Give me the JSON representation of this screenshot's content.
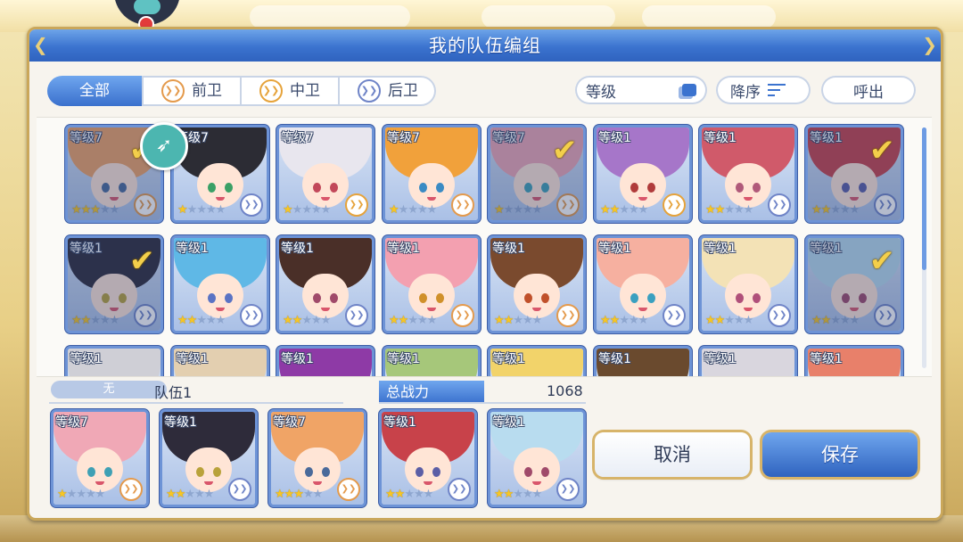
{
  "dialog": {
    "title": "我的队伍编组"
  },
  "filters": {
    "all": "全部",
    "front": "前卫",
    "middle": "中卫",
    "back": "后卫"
  },
  "controls": {
    "level_sort": "等级",
    "order": "降序",
    "call": "呼出"
  },
  "roster": [
    {
      "level": "等级7",
      "stars": 3,
      "role": "front",
      "selected": true,
      "hair": "#f0a466",
      "eye": "#4a6a9a"
    },
    {
      "level": "等级7",
      "stars": 1,
      "role": "back",
      "selected": false,
      "hair": "#2c2c34",
      "eye": "#3aa066"
    },
    {
      "level": "等级7",
      "stars": 1,
      "role": "mid",
      "selected": false,
      "hair": "#e8e6ee",
      "eye": "#c2485a"
    },
    {
      "level": "等级7",
      "stars": 1,
      "role": "front",
      "selected": false,
      "hair": "#f1a13b",
      "eye": "#3a8bc4"
    },
    {
      "level": "等级7",
      "stars": 1,
      "role": "front",
      "selected": true,
      "hair": "#f0a8b6",
      "eye": "#3fa0b4"
    },
    {
      "level": "等级1",
      "stars": 2,
      "role": "mid",
      "selected": false,
      "hair": "#a676c9",
      "eye": "#b03b3b"
    },
    {
      "level": "等级1",
      "stars": 2,
      "role": "back",
      "selected": false,
      "hair": "#d05a6a",
      "eye": "#b05a7a"
    },
    {
      "level": "等级1",
      "stars": 2,
      "role": "back",
      "selected": true,
      "hair": "#c8424a",
      "eye": "#5b5ea6"
    },
    {
      "level": "等级1",
      "stars": 2,
      "role": "back",
      "selected": true,
      "hair": "#2e2b3a",
      "eye": "#b9a23a"
    },
    {
      "level": "等级1",
      "stars": 2,
      "role": "back",
      "selected": false,
      "hair": "#5fb8e6",
      "eye": "#5a73c4"
    },
    {
      "level": "等级1",
      "stars": 2,
      "role": "back",
      "selected": false,
      "hair": "#4a2f28",
      "eye": "#a04a6a"
    },
    {
      "level": "等级1",
      "stars": 2,
      "role": "front",
      "selected": false,
      "hair": "#f3a0b0",
      "eye": "#d0902a"
    },
    {
      "level": "等级1",
      "stars": 2,
      "role": "front",
      "selected": false,
      "hair": "#7a4a2e",
      "eye": "#c0502a"
    },
    {
      "level": "等级1",
      "stars": 2,
      "role": "back",
      "selected": false,
      "hair": "#f6b0a0",
      "eye": "#3aa0c0"
    },
    {
      "level": "等级1",
      "stars": 2,
      "role": "back",
      "selected": false,
      "hair": "#f3e2b6",
      "eye": "#b0507a"
    },
    {
      "level": "等级1",
      "stars": 2,
      "role": "back",
      "selected": true,
      "hair": "#b8dcef",
      "eye": "#a04a6a"
    },
    {
      "level": "等级1",
      "stars": 0,
      "role": "back",
      "selected": false,
      "hair": "#cfcfd6",
      "eye": "#6a6a7a"
    },
    {
      "level": "等级1",
      "stars": 0,
      "role": "back",
      "selected": false,
      "hair": "#e3cfb0",
      "eye": "#6a6a7a"
    },
    {
      "level": "等级1",
      "stars": 0,
      "role": "back",
      "selected": false,
      "hair": "#8e3aa6",
      "eye": "#6a6a7a"
    },
    {
      "level": "等级1",
      "stars": 0,
      "role": "back",
      "selected": false,
      "hair": "#a6c77a",
      "eye": "#6a6a7a"
    },
    {
      "level": "等级1",
      "stars": 0,
      "role": "back",
      "selected": false,
      "hair": "#f2d36a",
      "eye": "#6a6a7a"
    },
    {
      "level": "等级1",
      "stars": 0,
      "role": "back",
      "selected": false,
      "hair": "#6a4a2e",
      "eye": "#6a6a7a"
    },
    {
      "level": "等级1",
      "stars": 0,
      "role": "back",
      "selected": false,
      "hair": "#d9d6de",
      "eye": "#6a6a7a"
    },
    {
      "level": "等级1",
      "stars": 0,
      "role": "back",
      "selected": false,
      "hair": "#e8806a",
      "eye": "#6a6a7a"
    }
  ],
  "team": {
    "group": "无",
    "name": "队伍1",
    "power_label": "总战力",
    "power_value": "1068",
    "members": [
      {
        "level": "等级7",
        "stars": 1,
        "role": "front",
        "hair": "#f0a8b6",
        "eye": "#3fa0b4"
      },
      {
        "level": "等级1",
        "stars": 2,
        "role": "back",
        "hair": "#2e2b3a",
        "eye": "#b9a23a"
      },
      {
        "level": "等级7",
        "stars": 3,
        "role": "front",
        "hair": "#f0a466",
        "eye": "#4a6a9a"
      },
      {
        "level": "等级1",
        "stars": 2,
        "role": "back",
        "hair": "#c8424a",
        "eye": "#5b5ea6"
      },
      {
        "level": "等级1",
        "stars": 2,
        "role": "back",
        "hair": "#b8dcef",
        "eye": "#a04a6a"
      }
    ]
  },
  "buttons": {
    "cancel": "取消",
    "save": "保存"
  },
  "icons": {
    "quick": "rocket-icon",
    "sort": "sort-lines-icon",
    "level": "stack-icon",
    "check": "checkmark-icon"
  }
}
